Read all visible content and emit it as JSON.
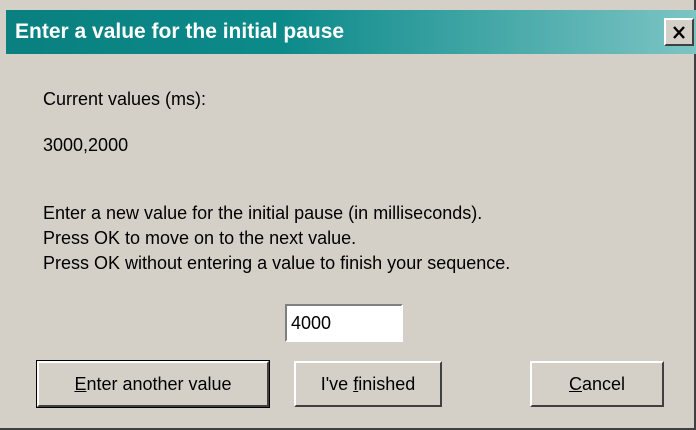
{
  "window": {
    "title": "Enter a value for the initial pause",
    "close_label": "×"
  },
  "content": {
    "current_label": "Current values (ms):",
    "current_values": "3000,2000",
    "instructions": [
      "Enter a new value for the initial pause (in milliseconds).",
      "Press OK to move on to the next value.",
      "Press OK without entering a value to finish your sequence."
    ],
    "input_value": "4000"
  },
  "buttons": {
    "enter_another": {
      "mnemonic": "E",
      "rest": "nter another value"
    },
    "finished": {
      "pre": "I've ",
      "mnemonic": "f",
      "rest": "inished"
    },
    "cancel": {
      "mnemonic": "C",
      "rest": "ancel"
    }
  },
  "colors": {
    "titlebar_start": "#0a8080",
    "titlebar_end": "#7cc4c4",
    "face": "#d4d0c8"
  }
}
